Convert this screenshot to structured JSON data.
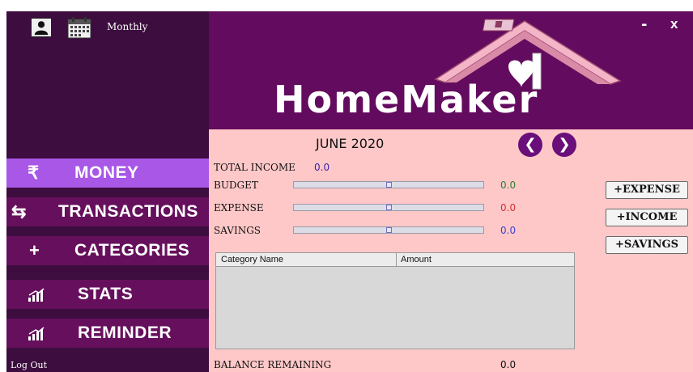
{
  "sidebar": {
    "period_label": "Monthly",
    "items": [
      {
        "label": "MONEY",
        "icon": "₹"
      },
      {
        "label": "TRANSACTIONS",
        "icon": "⇆"
      },
      {
        "label": "CATEGORIES",
        "icon": "+"
      },
      {
        "label": "STATS",
        "icon": "bar-chart-icon"
      },
      {
        "label": "REMINDER",
        "icon": "bar-chart-icon"
      }
    ],
    "logout_label": "Log Out"
  },
  "header": {
    "brand": "HomeMaker",
    "minimize_label": "-",
    "close_label": "x"
  },
  "main": {
    "month_title": "JUNE 2020",
    "prev_label": "❮",
    "next_label": "❯",
    "total_income_label": "TOTAL INCOME",
    "total_income_value": "0.0",
    "budget_label": "BUDGET",
    "budget_value": "0.0",
    "expense_label": "EXPENSE",
    "expense_value": "0.0",
    "savings_label": "SAVINGS",
    "savings_value": "0.0",
    "add_expense_label": "+EXPENSE",
    "add_income_label": "+INCOME",
    "add_savings_label": "+SAVINGS",
    "table": {
      "columns": [
        "Category Name",
        "Amount"
      ],
      "rows": []
    },
    "balance_label": "BALANCE REMAINING",
    "balance_value": "0.0"
  },
  "colors": {
    "sidebar_bg": "#3c0d3e",
    "nav_item_bg": "#66105d",
    "nav_active_bg": "#a857e6",
    "header_bg": "#630b5e",
    "main_bg": "#ffc8c8",
    "budget_value_color": "#2e7d32",
    "expense_value_color": "#d32f2f",
    "savings_value_color": "#3f3fd0",
    "income_value_color": "#3b1fa8"
  }
}
